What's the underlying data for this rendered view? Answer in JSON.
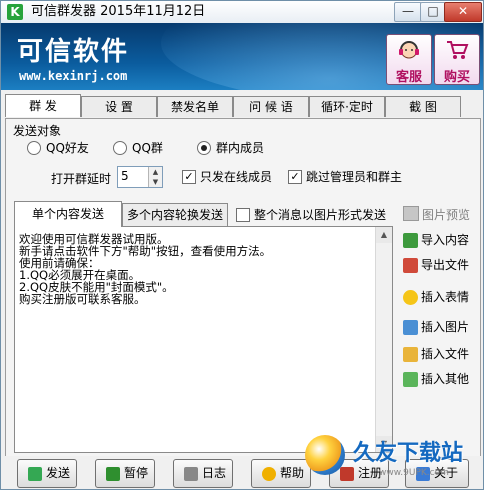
{
  "window": {
    "title": "可信群发器 2015年11月12日",
    "app_icon_letter": "K",
    "controls": {
      "minimize": "—",
      "maximize": "□",
      "close": "✕"
    }
  },
  "banner": {
    "brand": "可信软件",
    "url": "www.kexinrj.com",
    "service_label": "客服",
    "buy_label": "购买"
  },
  "tabs": [
    "群 发",
    "设 置",
    "禁发名单",
    "问 候 语",
    "循环·定时",
    "截 图"
  ],
  "send_target": {
    "label": "发送对象",
    "options": [
      "QQ好友",
      "QQ群",
      "群内成员"
    ],
    "selected_index": 2
  },
  "options_row": {
    "delay_label": "打开群延时",
    "delay_value": "5",
    "only_online_label": "只发在线成员",
    "only_online_checked": true,
    "skip_admin_label": "跳过管理员和群主",
    "skip_admin_checked": true
  },
  "content_tabs": [
    "单个内容发送",
    "多个内容轮换发送"
  ],
  "send_as_image_label": "整个消息以图片形式发送",
  "send_as_image_checked": false,
  "preview_label": "图片预览",
  "editor_text": "欢迎使用可信群发器试用版。\n新手请点击软件下方\"帮助\"按钮，查看使用方法。\n使用前请确保：\n1.QQ必须展开在桌面。\n2.QQ皮肤不能用\"封面模式\"。\n购买注册版可联系客服。",
  "side_buttons": [
    "导入内容",
    "导出文件",
    "插入表情",
    "插入图片",
    "插入文件",
    "插入其他"
  ],
  "bottom_buttons": [
    "发送",
    "暂停",
    "日志",
    "帮助",
    "注册",
    "关于"
  ],
  "watermark": {
    "text": "久友下载站",
    "url": "www.9UPK.com"
  },
  "colors": {
    "banner": "#0b5c9e",
    "close_button": "#c0392b",
    "brand_pink": "#b01060",
    "watermark_blue": "#1469c0"
  }
}
